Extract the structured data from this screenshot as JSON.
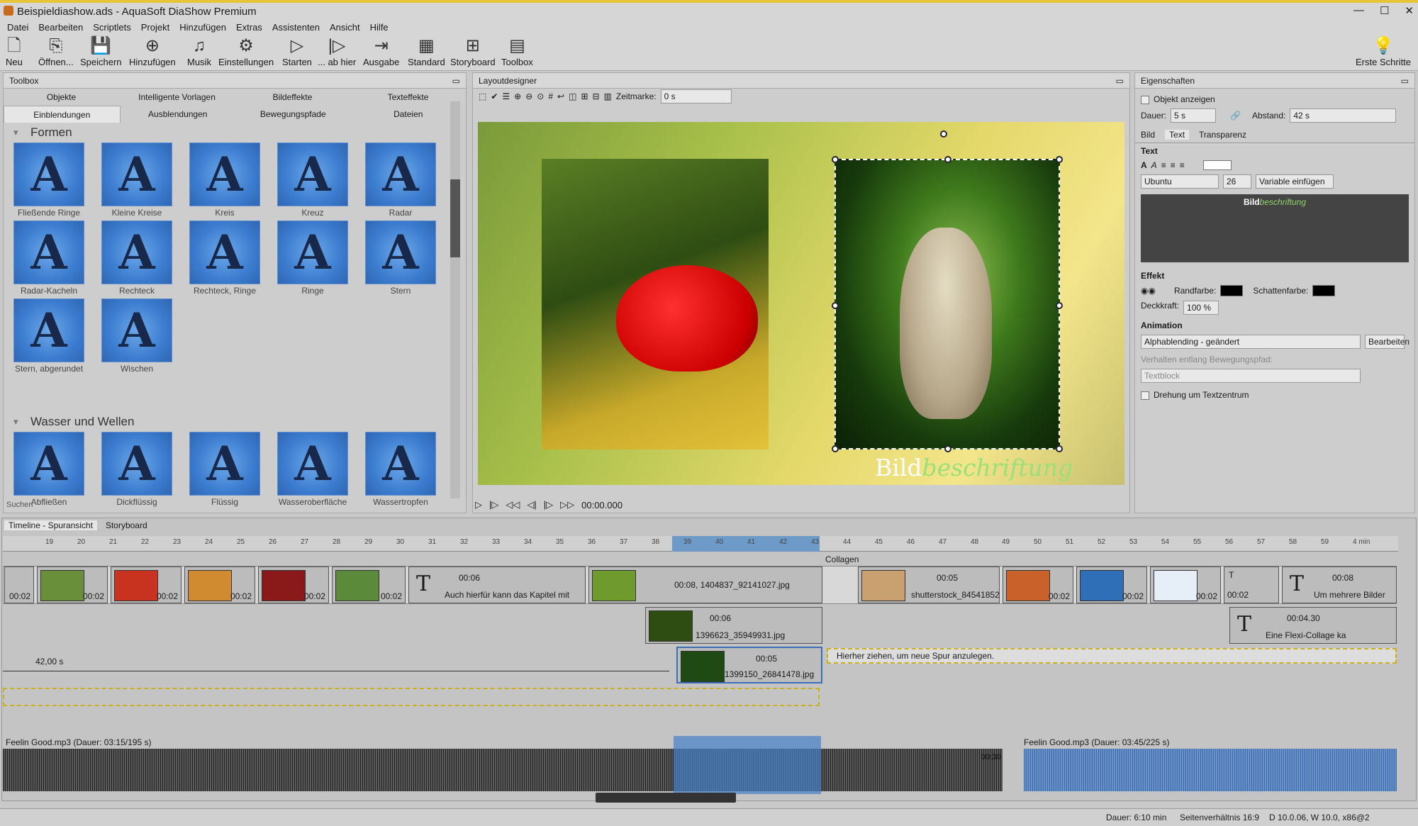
{
  "window": {
    "title": "Beispieldiashow.ads - AquaSoft DiaShow Premium",
    "controls": [
      "—",
      "☐",
      "✕"
    ]
  },
  "menu": [
    "Datei",
    "Bearbeiten",
    "Scriptlets",
    "Projekt",
    "Hinzufügen",
    "Extras",
    "Assistenten",
    "Ansicht",
    "Hilfe"
  ],
  "toolbar": [
    "Neu",
    "Öffnen...",
    "Speichern",
    "Hinzufügen",
    "Musik",
    "Einstellungen",
    "Starten",
    "... ab hier",
    "Ausgabe",
    "Standard",
    "Storyboard",
    "Toolbox"
  ],
  "toolbar_right": "Erste Schritte",
  "toolbox": {
    "title": "Toolbox",
    "tabs1": [
      "Objekte",
      "Intelligente Vorlagen",
      "Bildeffekte",
      "Texteffekte"
    ],
    "tabs2": [
      "Einblendungen",
      "Ausblendungen",
      "Bewegungspfade",
      "Dateien"
    ],
    "section1": "Formen",
    "shapes": [
      "Fließende Ringe",
      "Kleine Kreise",
      "Kreis",
      "Kreuz",
      "Radar",
      "Radar-Kacheln",
      "Rechteck",
      "Rechteck, Ringe",
      "Ringe",
      "Stern",
      "Stern, abgerundet",
      "Wischen"
    ],
    "section2": "Wasser und Wellen",
    "water": [
      "Abfließen",
      "Dickflüssig",
      "Flüssig",
      "Wasseroberfläche",
      "Wassertropfen"
    ],
    "search": "Suchen",
    "glyph": "A"
  },
  "layout": {
    "title": "Layoutdesigner",
    "timestamp_label": "Zeitmarke:",
    "timestamp": "0 s",
    "time": "00:00.000",
    "caption_a": "Bild",
    "caption_b": "beschriftung"
  },
  "props": {
    "title": "Eigenschaften",
    "show": "Objekt anzeigen",
    "dauer_label": "Dauer:",
    "dauer": "5 s",
    "abstand_label": "Abstand:",
    "abstand": "42 s",
    "tabs": [
      "Bild",
      "Text",
      "Transparenz"
    ],
    "text_label": "Text",
    "font": "Ubuntu",
    "size": "26",
    "variable": "Variable einfügen",
    "preview_a": "Bild",
    "preview_b": "beschriftung",
    "effekt": "Effekt",
    "randfarbe": "Randfarbe:",
    "schattenfarbe": "Schattenfarbe:",
    "deckkraft_label": "Deckkraft:",
    "deckkraft": "100 %",
    "animation": "Animation",
    "anim_value": "Alphablending - geändert",
    "bearbeiten": "Bearbeiten",
    "path_label": "Verhalten entlang Bewegungspfad:",
    "path_value": "Textblock",
    "rotate": "Drehung um Textzentrum"
  },
  "timeline": {
    "tabs": [
      "Timeline - Spuransicht",
      "Storyboard"
    ],
    "ruler": [
      "19",
      "20",
      "21",
      "22",
      "23",
      "24",
      "25",
      "26",
      "27",
      "28",
      "29",
      "30",
      "31",
      "32",
      "33",
      "34",
      "35",
      "36",
      "37",
      "38",
      "39",
      "40",
      "41",
      "42",
      "43",
      "44",
      "45",
      "46",
      "47",
      "48",
      "49",
      "50",
      "51",
      "52",
      "53",
      "54",
      "55",
      "56",
      "57",
      "58",
      "59",
      "4 min"
    ],
    "clips_row1": [
      "00:02",
      "00:02",
      "00:02",
      "00:02",
      "00:02",
      "00:02"
    ],
    "text_clip_time": "00:06",
    "text_clip_label": "Auch hierfür kann das Kapitel mit",
    "img_clip": "00:08, 1404837_92141027.jpg",
    "collage": "Collagen",
    "collage_clip_time": "00:05",
    "collage_clip_name": "shutterstock_84541852",
    "collage_small": [
      "00:02",
      "00:02",
      "00:02",
      "00:02"
    ],
    "text2_time": "00:08",
    "text2_label": "Um mehrere Bilder",
    "row2_time": "00:06",
    "row2_name": "1396623_35949931.jpg",
    "flexi_time": "00:04.30",
    "flexi_label": "Eine Flexi-Collage ka",
    "row3_time": "00:05",
    "row3_name": "1399150_26841478.jpg",
    "duration_marker": "42,00 s",
    "hint": "Hierher ziehen, um neue Spur anzulegen.",
    "audio1": "Feelin Good.mp3 (Dauer: 03:15/195 s)",
    "audio_marker": "00:30",
    "audio2": "Feelin Good.mp3 (Dauer: 03:45/225 s)"
  },
  "status": {
    "dauer": "Dauer: 6:10 min",
    "ratio": "Seitenverhältnis 16:9",
    "version": "D 10.0.06, W 10.0, x86@2"
  }
}
